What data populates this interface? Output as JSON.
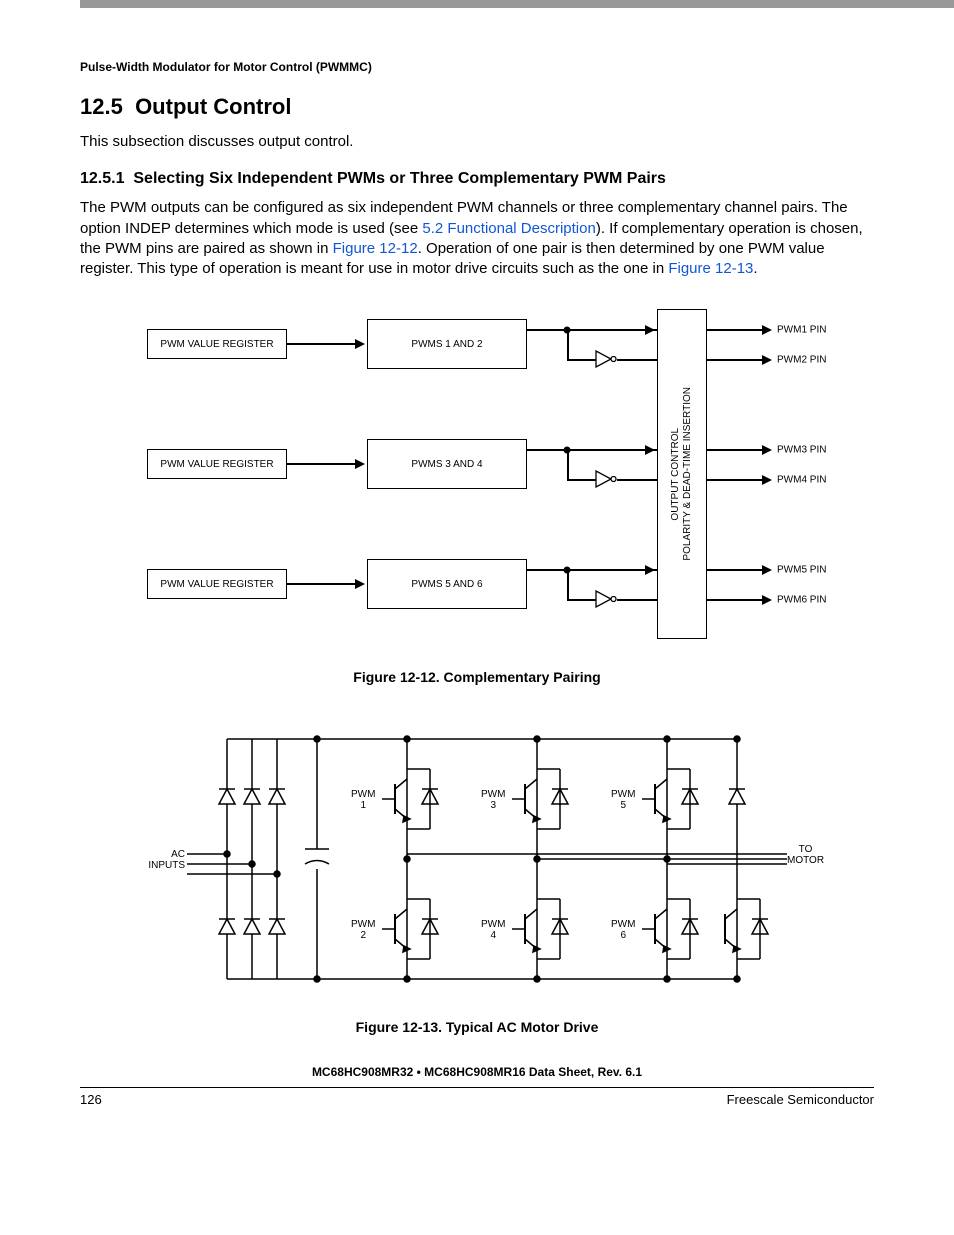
{
  "header": "Pulse-Width Modulator for Motor Control (PWMMC)",
  "section": {
    "number": "12.5",
    "title": "Output Control"
  },
  "intro": "This subsection discusses output control.",
  "subsection": {
    "number": "12.5.1",
    "title": "Selecting Six Independent PWMs or Three Complementary PWM Pairs"
  },
  "para1_a": "The PWM outputs can be configured as six independent PWM channels or three complementary channel pairs. The option INDEP determines which mode is used (see ",
  "link1": "5.2 Functional Description",
  "para1_b": "). If complementary operation is chosen, the PWM pins are paired as shown in ",
  "link2": "Figure 12-12",
  "para1_c": ". Operation of one pair is then determined by one PWM value register. This type of operation is meant for use in motor drive circuits such as the one in ",
  "link3": "Figure 12-13",
  "para1_d": ".",
  "fig1": {
    "caption": "Figure 12-12. Complementary Pairing",
    "reg_label": "PWM VALUE REGISTER",
    "pair_labels": [
      "PWMS 1 AND 2",
      "PWMS 3 AND 4",
      "PWMS 5 AND 6"
    ],
    "out_block": {
      "line1": "OUTPUT CONTROL",
      "line2": "POLARITY & DEAD-TIME INSERTION"
    },
    "pins": [
      "PWM1 PIN",
      "PWM2 PIN",
      "PWM3 PIN",
      "PWM4 PIN",
      "PWM5 PIN",
      "PWM6 PIN"
    ]
  },
  "fig2": {
    "caption": "Figure 12-13. Typical AC Motor Drive",
    "ac_label": "AC\nINPUTS",
    "to_motor": "TO\nMOTOR",
    "pwm_labels": [
      "PWM\n1",
      "PWM\n2",
      "PWM\n3",
      "PWM\n4",
      "PWM\n5",
      "PWM\n6"
    ]
  },
  "footer": {
    "title": "MC68HC908MR32 • MC68HC908MR16 Data Sheet, Rev. 6.1",
    "page": "126",
    "vendor": "Freescale Semiconductor"
  }
}
